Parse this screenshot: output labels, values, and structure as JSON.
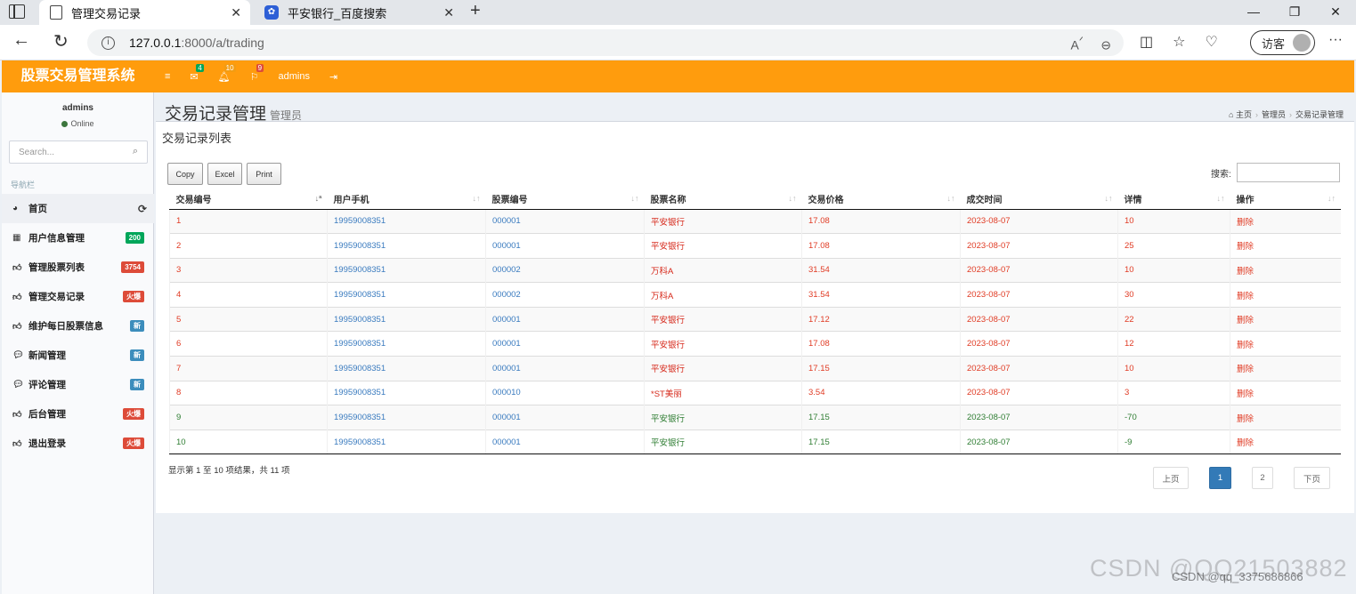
{
  "browser": {
    "tabs": [
      {
        "title": "管理交易记录",
        "active": true
      },
      {
        "title": "平安银行_百度搜索",
        "active": false
      }
    ],
    "url_host": "127.0.0.1",
    "url_path": ":8000/a/trading",
    "guest_label": "访客"
  },
  "header": {
    "logo": "股票交易管理系统",
    "mail_count": "4",
    "bell_count": "10",
    "flag_count": "9",
    "user": "admins"
  },
  "sidebar": {
    "user_name": "admins",
    "status": "Online",
    "search_placeholder": "Search...",
    "nav_header": "导航栏",
    "items": [
      {
        "label": "首页",
        "icon": "dashboard-icon",
        "badge": ""
      },
      {
        "label": "用户信息管理",
        "icon": "grid-icon",
        "badge": "200",
        "badge_color": "#00a65a"
      },
      {
        "label": "管理股票列表",
        "icon": "thumbs-up-icon",
        "badge": "3754",
        "badge_color": "#dd4b39"
      },
      {
        "label": "管理交易记录",
        "icon": "thumbs-up-icon",
        "badge": "火爆",
        "badge_color": "#dd4b39"
      },
      {
        "label": "维护每日股票信息",
        "icon": "thumbs-up-icon",
        "badge": "新",
        "badge_color": "#3c8dbc"
      },
      {
        "label": "新闻管理",
        "icon": "comment-icon",
        "badge": "新",
        "badge_color": "#3c8dbc"
      },
      {
        "label": "评论管理",
        "icon": "comment-icon",
        "badge": "新",
        "badge_color": "#3c8dbc"
      },
      {
        "label": "后台管理",
        "icon": "thumbs-up-icon",
        "badge": "火爆",
        "badge_color": "#dd4b39"
      },
      {
        "label": "退出登录",
        "icon": "thumbs-up-icon",
        "badge": "火爆",
        "badge_color": "#dd4b39"
      }
    ]
  },
  "page": {
    "title": "交易记录管理",
    "subtitle": "管理员",
    "breadcrumb": [
      "主页",
      "管理员",
      "交易记录管理"
    ],
    "box_title": "交易记录列表"
  },
  "table": {
    "buttons": [
      "Copy",
      "Excel",
      "Print"
    ],
    "search_label": "搜索:",
    "columns": [
      "交易编号",
      "用户手机",
      "股票编号",
      "股票名称",
      "交易价格",
      "成交时间",
      "详情",
      "操作"
    ],
    "rows": [
      {
        "id": "1",
        "phone": "19959008351",
        "code": "000001",
        "name": "平安银行",
        "price": "17.08",
        "time": "2023-08-07",
        "detail": "10",
        "action": "删除",
        "type": "buy"
      },
      {
        "id": "2",
        "phone": "19959008351",
        "code": "000001",
        "name": "平安银行",
        "price": "17.08",
        "time": "2023-08-07",
        "detail": "25",
        "action": "删除",
        "type": "buy"
      },
      {
        "id": "3",
        "phone": "19959008351",
        "code": "000002",
        "name": "万科A",
        "price": "31.54",
        "time": "2023-08-07",
        "detail": "10",
        "action": "删除",
        "type": "buy"
      },
      {
        "id": "4",
        "phone": "19959008351",
        "code": "000002",
        "name": "万科A",
        "price": "31.54",
        "time": "2023-08-07",
        "detail": "30",
        "action": "删除",
        "type": "buy"
      },
      {
        "id": "5",
        "phone": "19959008351",
        "code": "000001",
        "name": "平安银行",
        "price": "17.12",
        "time": "2023-08-07",
        "detail": "22",
        "action": "删除",
        "type": "buy"
      },
      {
        "id": "6",
        "phone": "19959008351",
        "code": "000001",
        "name": "平安银行",
        "price": "17.08",
        "time": "2023-08-07",
        "detail": "12",
        "action": "删除",
        "type": "buy"
      },
      {
        "id": "7",
        "phone": "19959008351",
        "code": "000001",
        "name": "平安银行",
        "price": "17.15",
        "time": "2023-08-07",
        "detail": "10",
        "action": "删除",
        "type": "buy"
      },
      {
        "id": "8",
        "phone": "19959008351",
        "code": "000010",
        "name": "*ST美丽",
        "price": "3.54",
        "time": "2023-08-07",
        "detail": "3",
        "action": "删除",
        "type": "buy"
      },
      {
        "id": "9",
        "phone": "19959008351",
        "code": "000001",
        "name": "平安银行",
        "price": "17.15",
        "time": "2023-08-07",
        "detail": "-70",
        "action": "删除",
        "type": "sell"
      },
      {
        "id": "10",
        "phone": "19959008351",
        "code": "000001",
        "name": "平安银行",
        "price": "17.15",
        "time": "2023-08-07",
        "detail": "-9",
        "action": "删除",
        "type": "sell"
      }
    ],
    "info": "显示第 1 至 10 项结果，共 11 项",
    "pager": {
      "prev": "上页",
      "pages": [
        "1",
        "2"
      ],
      "next": "下页"
    }
  },
  "watermark": "CSDN @QQ21503882",
  "watermark_small": "CSDN @qq_3375686866"
}
